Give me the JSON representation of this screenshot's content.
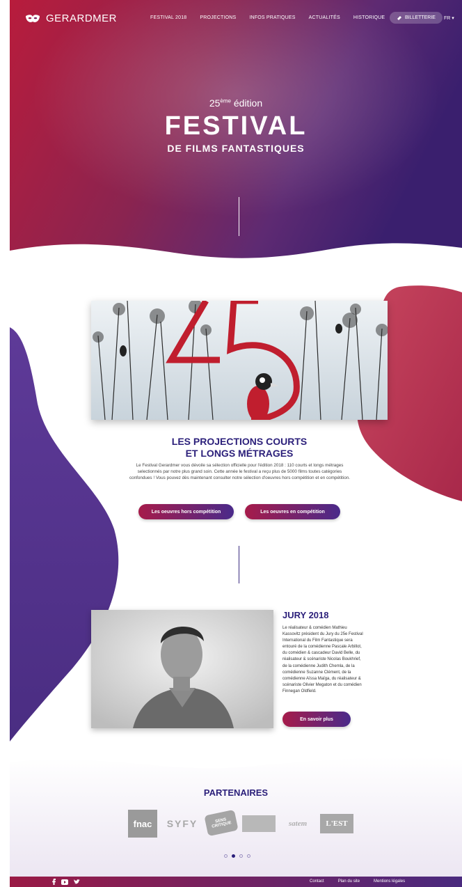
{
  "brand": {
    "name": "GERARDMER"
  },
  "nav": {
    "items": [
      "FESTIVAL 2018",
      "PROJECTIONS",
      "INFOS PRATIQUES",
      "ACTUALITÉS",
      "HISTORIQUE"
    ],
    "ticket_label": "BILLETTERIE",
    "lang_label": "FR ▾"
  },
  "hero": {
    "edition_number": "25",
    "edition_suffix": "ème",
    "edition_word": "édition",
    "title": "FESTIVAL",
    "subtitle": "DE FILMS FANTASTIQUES"
  },
  "projections": {
    "title_line1": "LES PROJECTIONS COURTS",
    "title_line2": "ET LONGS MÉTRAGES",
    "text": "Le Festival Gerardmer vous dévoile sa sélection officielle pour l'édition 2018 : 110 courts et longs métrages selectionnés par notre plus grand soin. Cette année le festival a reçu plus de 5000 films toutes catégories confondues ! Vous pouvez dès maintenant consulter notre sélection d'oeuvres hors compétition et en compétition.",
    "btn_hors": "Les oeuvres hors compétition",
    "btn_en": "Les oeuvres en compétition"
  },
  "jury": {
    "title": "JURY 2018",
    "text": "Le réalisateur & comédien Mathieu Kassovitz président du Jury du 25e Festival International du Film Fantastique sera entouré de la comédienne Pascale Arbillot, du comédien & cascadeur David Belle, du réalisateur & scénariste Nicolas Boukhrief, de la comédienne Judith Chemla, de la comédienne Suzanne Clément, de la comédienne Aïssa Maïga, du réalisateur & scénariste Olivier Megaton et du comédien Finnegan Oldfield.",
    "btn": "En savoir plus"
  },
  "partners": {
    "title": "PARTENAIRES",
    "logos": [
      "fnac",
      "SYFY",
      "SENS CRITIQUE",
      "—",
      "satem",
      "L'EST"
    ]
  },
  "footer": {
    "links": [
      "Contact",
      "Plan du site",
      "Mentions légales"
    ]
  },
  "colors": {
    "accent_red": "#a61b4a",
    "accent_purple": "#4a2a8a",
    "title_blue": "#2b1f7a"
  }
}
